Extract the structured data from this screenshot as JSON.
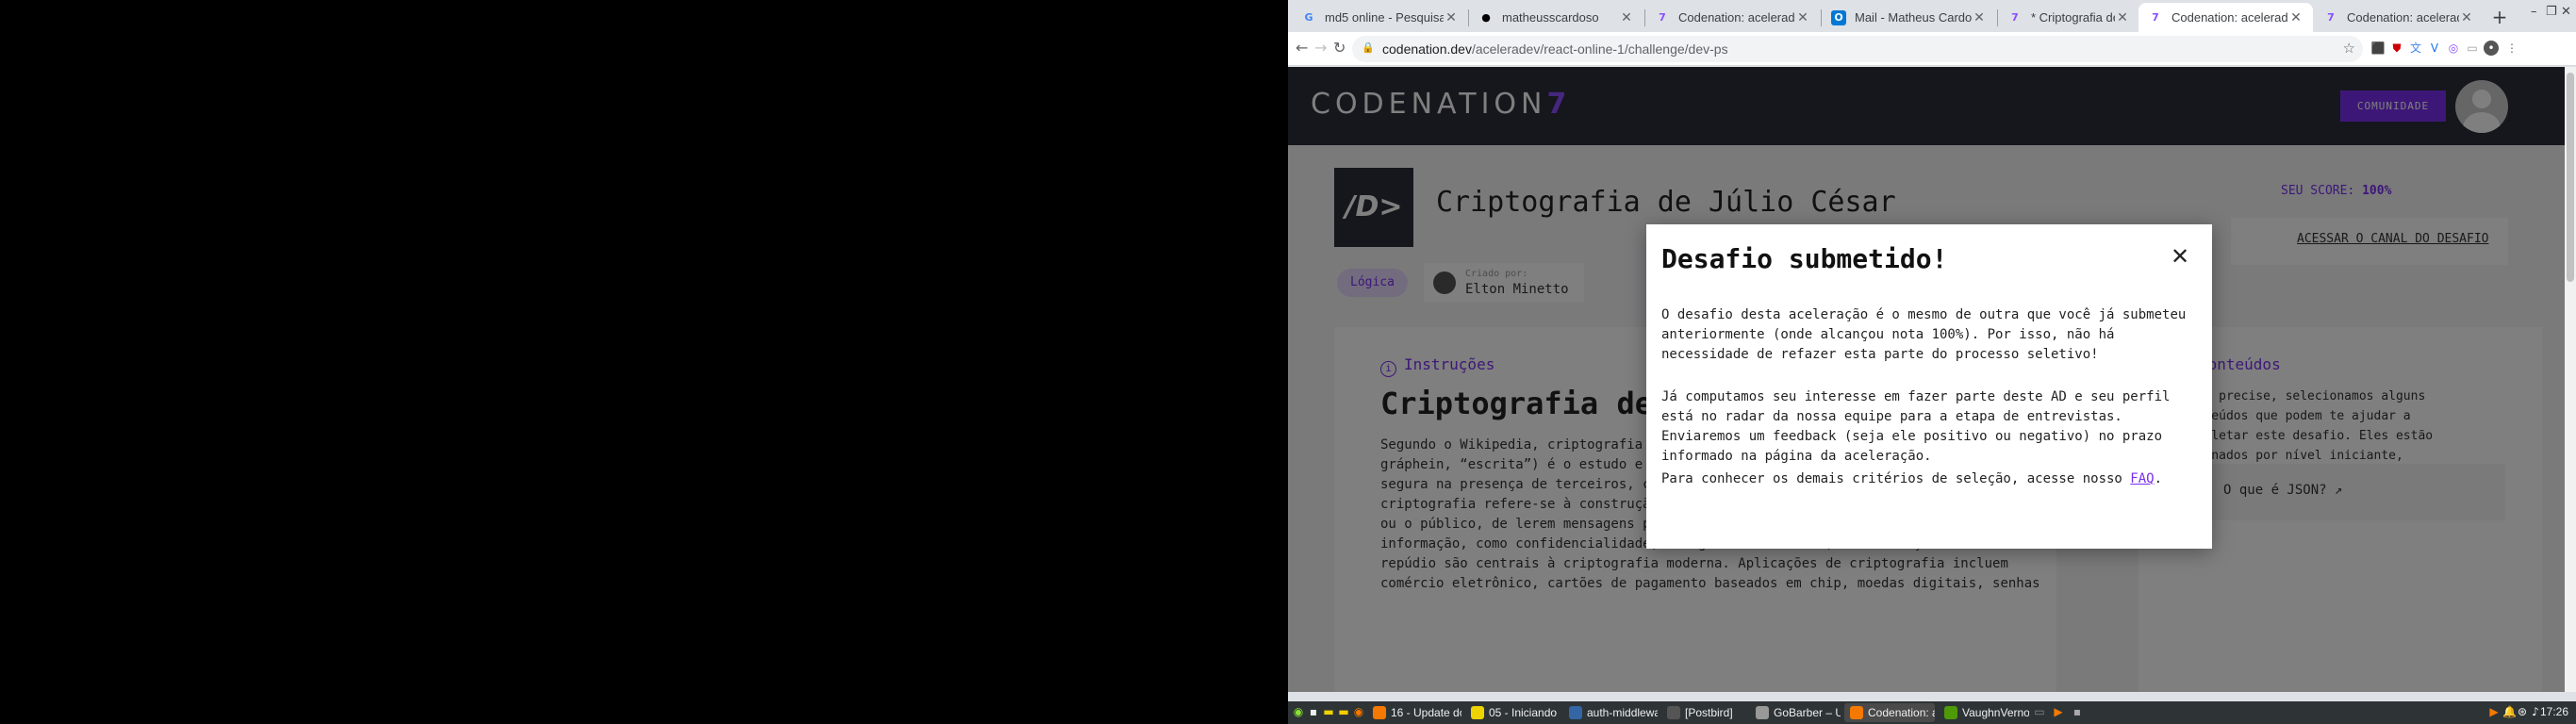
{
  "browser": {
    "tabs": [
      {
        "title": "md5 online - Pesquisa Google",
        "icon": "google-icon"
      },
      {
        "title": "matheusscardoso",
        "icon": "github-icon"
      },
      {
        "title": "Codenation: aceleradev",
        "icon": "codenation-icon"
      },
      {
        "title": "Mail - Matheus Cardoso",
        "icon": "outlook-icon"
      },
      {
        "title": "* Criptografia de Júlio",
        "icon": "codenation-icon"
      },
      {
        "title": "Codenation: aceleradev",
        "icon": "codenation-icon"
      },
      {
        "title": "Codenation: aceleradev",
        "icon": "codenation-icon"
      }
    ],
    "url_host": "codenation.dev",
    "url_path": "/aceleradev/react-online-1/challenge/dev-ps"
  },
  "site": {
    "logo_text": "CODENATION",
    "logo_mark": "7",
    "community_label": "COMUNIDADE"
  },
  "challenge": {
    "icon_text": "/D>",
    "title": "Criptografia de Júlio César",
    "score_label": "SEU SCORE: ",
    "score_value": "100%",
    "channel_link": "ACESSAR O CANAL DO DESAFIO",
    "tag": "Lógica",
    "author_label": "Criado por:",
    "author_name": "Elton Minetto"
  },
  "instructions": {
    "heading": "Instruções",
    "article_title": "Criptografia de J",
    "body": "Segundo o Wikipedia, criptografia ou criptologia (em grego: kryptós, “escondido”, e gráphein, “escrita”) é o estudo e prática de princípios e técnicas para comunicação segura na presença de terceiros, chamados “adversários”. Mas geralmente, a criptografia refere-se à construção e análise de protocolos que impedem terceiros, ou o público, de lerem mensagens privadas. Muitos aspectos em segurança da informação, como confidencialidade, integridade de dados, autenticação e não-repúdio são centrais à criptografia moderna. Aplicações de criptografia incluem comércio eletrônico, cartões de pagamento baseados em chip, moedas digitais, senhas"
  },
  "sidebar": {
    "heading": "Conteúdos",
    "text": "...o precise, selecionamos alguns ...teúdos que podem te ajudar a ...pletar este desafio. Eles estão ...enados por nível iniciante, introdutório e avançado. Bons estudos!",
    "link": "O que é JSON?"
  },
  "modal": {
    "title": "Desafio submetido!",
    "p1": "O desafio desta aceleração é o mesmo de outra que você já submeteu anteriormente (onde alcançou nota 100%). Por isso, não há necessidade de refazer esta parte do processo seletivo!",
    "p2": "Já computamos seu interesse em fazer parte deste AD e seu perfil está no radar da nossa equipe para a etapa de entrevistas. Enviaremos um feedback (seja ele positivo ou negativo) no prazo informado na página da aceleração.",
    "p3_prefix": "Para conhecer os demais critérios de seleção, acesse nosso ",
    "p3_link": "FAQ",
    "p3_suffix": "."
  },
  "taskbar": {
    "items": [
      "16 - Update do...",
      "05 - Iniciando ...",
      "auth-middlewa...",
      "[Postbird]",
      "GoBarber – Up...",
      "Codenation: ac...",
      "VaughnVerno..."
    ],
    "clock": "17:26"
  },
  "colors": {
    "brand": "#7a2ff0",
    "header_bg": "#2c2c3a"
  }
}
